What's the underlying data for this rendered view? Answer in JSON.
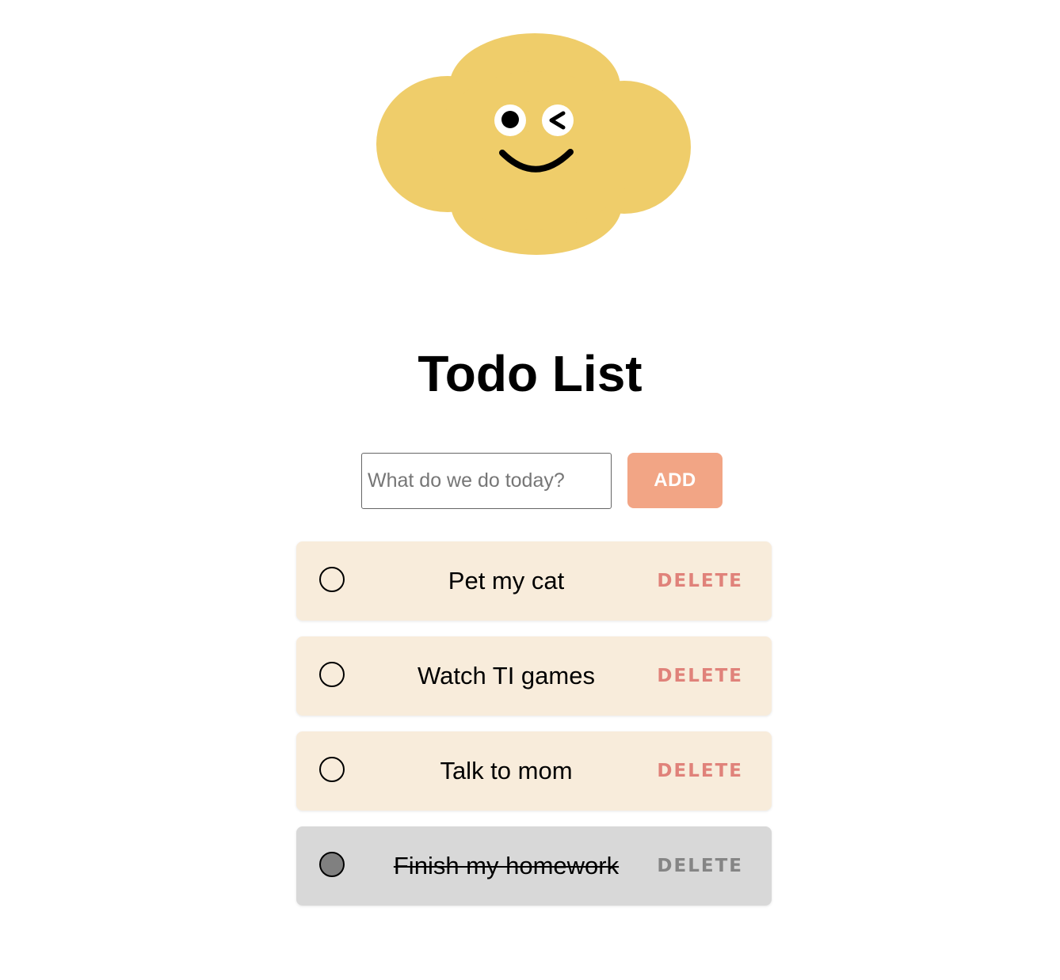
{
  "header": {
    "title": "Todo List"
  },
  "mascot": {
    "icon": "cloud-winking-face-icon",
    "color": "#EFCD6A"
  },
  "form": {
    "input_value": "",
    "input_placeholder": "What do we do today?",
    "add_label": "ADD",
    "add_color": "#F2A585"
  },
  "todos": [
    {
      "text": "Pet my cat",
      "done": false,
      "delete_label": "DELETE"
    },
    {
      "text": "Watch TI games",
      "done": false,
      "delete_label": "DELETE"
    },
    {
      "text": "Talk to mom",
      "done": false,
      "delete_label": "DELETE"
    },
    {
      "text": "Finish my homework",
      "done": true,
      "delete_label": "DELETE"
    }
  ],
  "colors": {
    "item_bg": "#F8ECDB",
    "item_done_bg": "#D8D8D8",
    "delete_color": "#E0827A",
    "delete_done_color": "#858585",
    "check_done_fill": "#808080"
  }
}
